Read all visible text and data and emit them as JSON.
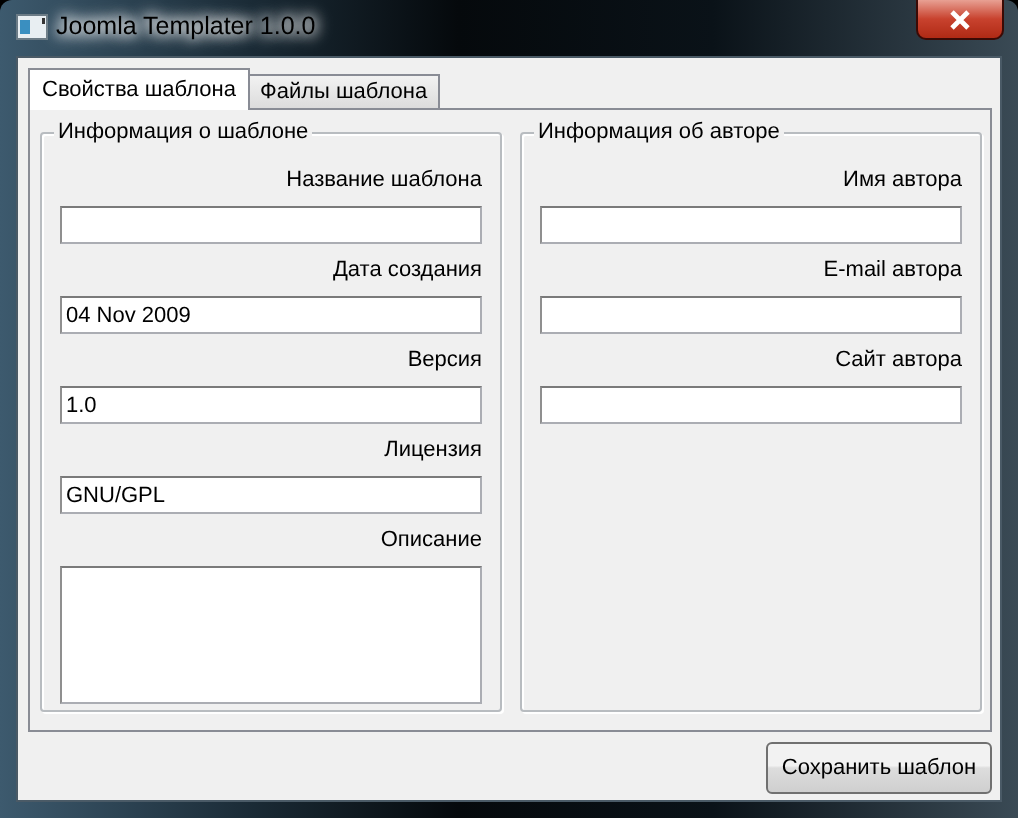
{
  "window": {
    "title": "Joomla Templater 1.0.0"
  },
  "tabs": [
    {
      "label": "Свойства шаблона",
      "selected": true
    },
    {
      "label": "Файлы шаблона",
      "selected": false
    }
  ],
  "groups": [
    {
      "title": "Информация о шаблоне",
      "fields": [
        {
          "label": "Название шаблона",
          "kind": "text"
        },
        {
          "label": "Дата создания",
          "kind": "text",
          "value": "04 Nov 2009"
        },
        {
          "label": "Версия",
          "kind": "text",
          "value": "1.0"
        },
        {
          "label": "Лицензия",
          "kind": "text",
          "value": "GNU/GPL"
        },
        {
          "label": "Описание",
          "kind": "multiline"
        }
      ]
    },
    {
      "title": "Информация об авторе",
      "fields": [
        {
          "label": "Имя автора",
          "kind": "text"
        },
        {
          "label": "E-mail автора",
          "kind": "text"
        },
        {
          "label": "Сайт автора",
          "kind": "text"
        }
      ]
    }
  ],
  "buttons": [
    "Сохранить шаблон"
  ]
}
